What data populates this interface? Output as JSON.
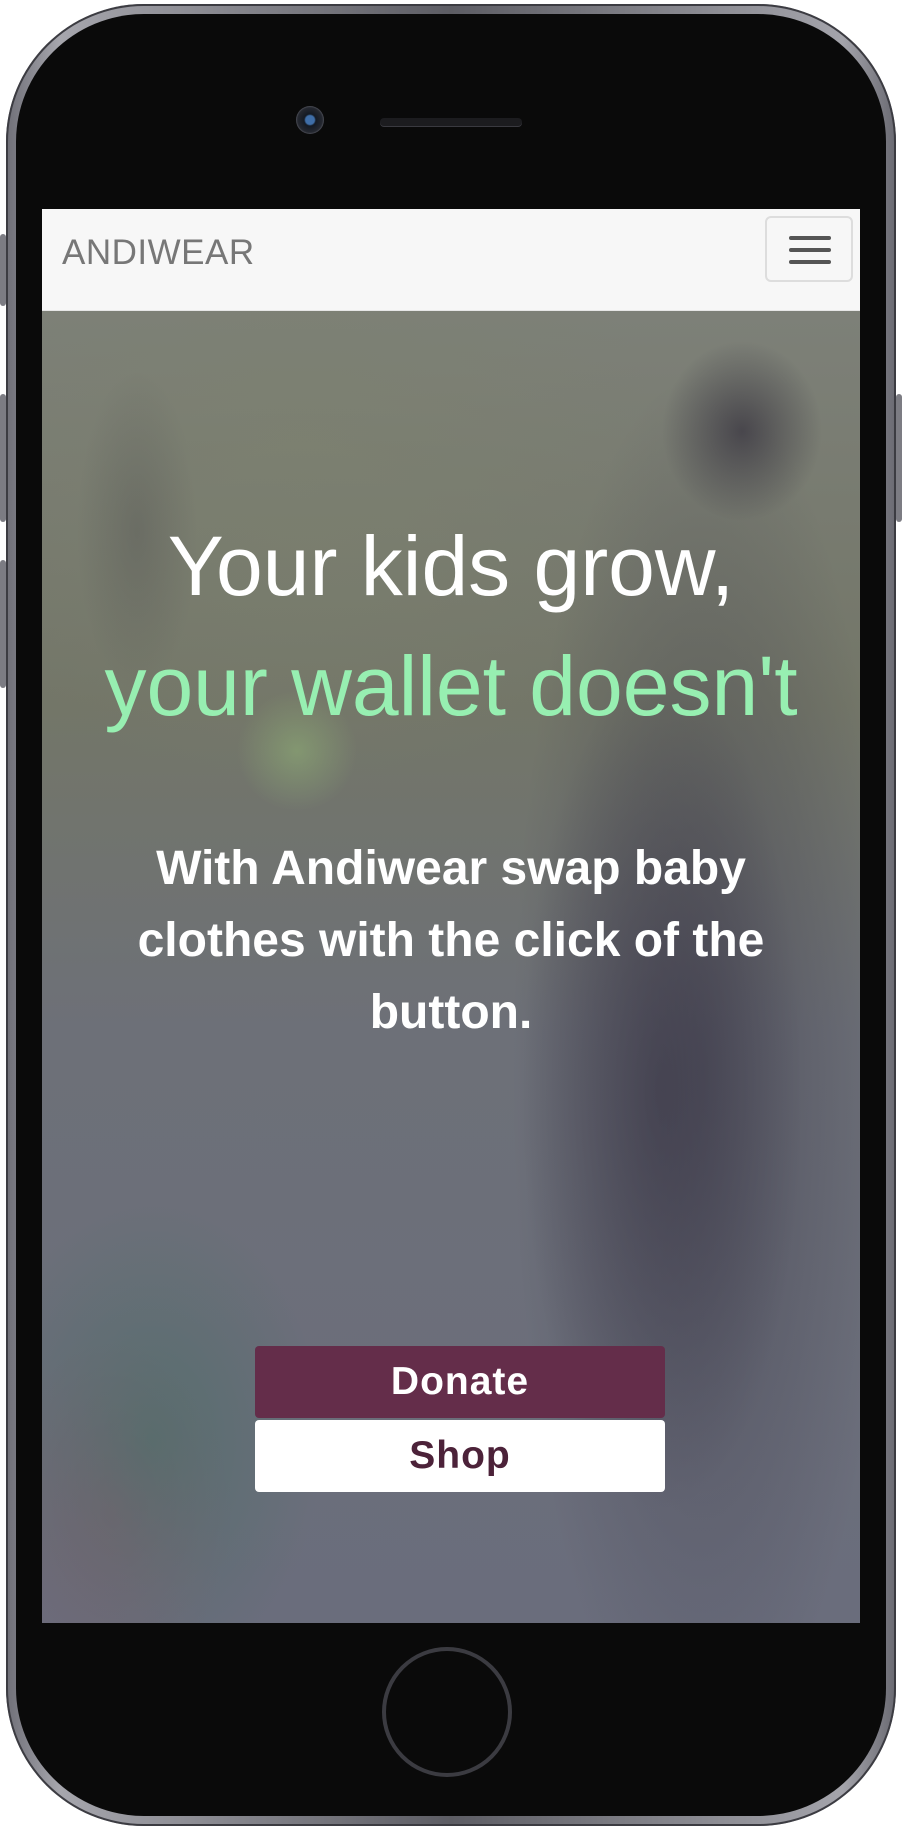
{
  "navbar": {
    "brand": "ANDIWEAR"
  },
  "hero": {
    "headline_line1": "Your kids grow,",
    "headline_line2": "your wallet doesn't",
    "tagline": "With Andiwear swap baby clothes with the click of the button."
  },
  "actions": {
    "donate_label": "Donate",
    "shop_label": "Shop"
  },
  "colors": {
    "accent_green": "#97efb1",
    "brand_plum": "#642d4a",
    "navbar_bg": "#f7f7f7"
  },
  "icons": {
    "menu": "hamburger-menu-icon"
  }
}
